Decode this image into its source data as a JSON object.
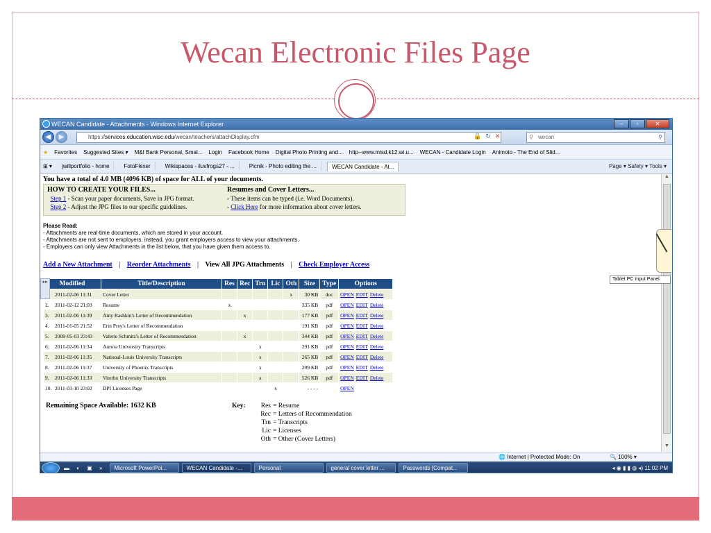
{
  "slide": {
    "title": "Wecan Electronic Files Page"
  },
  "window": {
    "title": "WECAN Candidate - Attachments - Windows Internet Explorer",
    "url_prefix": "https://",
    "url_domain": "services.education.wisc.edu",
    "url_path": "/wecan/teachers/attachDisplay.cfm",
    "search_value": "wecan"
  },
  "favorites": [
    "Favorites",
    "Suggested Sites ▾",
    "M&I Bank Personal, Smal...",
    "Login",
    "Facebook Home",
    "Digital Photo Printing and...",
    "http--www.misd.k12.wi.u...",
    "WECAN - Candidate Login",
    "Animoto - The End of Slid..."
  ],
  "tabs": [
    "jwillportfolio - home",
    "FotoFlexer",
    "Wikispaces - iluvfrogs27 - ...",
    "Picnik - Photo editing the ...",
    "WECAN Candidate - At..."
  ],
  "toolbar_tools": "Page ▾   Safety ▾   Tools ▾",
  "page": {
    "total_space": "You have a total of 4.0 MB (4096 KB) of space for ALL of your documents.",
    "howto": {
      "heading": "HOW TO CREATE YOUR FILES...",
      "step1_link": "Step 1",
      "step1_text": " - Scan your paper documents, Save in JPG format.",
      "step2_link": "Step 2",
      "step2_text": " - Adjust the JPG files to our specific guidelines.",
      "resumes_heading": "Resumes and Cover Letters...",
      "resumes_line1": "- These items can be typed (i.e. Word Documents).",
      "resumes_prefix": "- ",
      "resumes_link": "Click Here",
      "resumes_line2": " for more information about cover letters."
    },
    "please_read": {
      "heading": "Please Read:",
      "lines": [
        "- Attachments are real-time documents, which are stored in your account.",
        "- Attachments are not sent to employers, instead, you grant employers access to view your attachments.",
        "- Employers can only view Attachments in the list below, that you have given them access to."
      ]
    },
    "actions": {
      "add": "Add a New Attachment",
      "reorder": "Reorder Attachments",
      "view_all": "View All JPG Attachments",
      "check": "Check Employer Access",
      "sep": "|"
    },
    "table": {
      "headers": [
        "Modified",
        "Title/Description",
        "Res",
        "Rec",
        "Trn",
        "Lic",
        "Oth",
        "Size",
        "Type",
        "Options"
      ],
      "option_labels": [
        "OPEN",
        "EDIT",
        "Delete"
      ],
      "rows": [
        {
          "num": "1.",
          "modified": "2011-02-06 11:31",
          "title": "Cover Letter",
          "res": "",
          "rec": "",
          "trn": "",
          "lic": "",
          "oth": "x",
          "size": "30 KB",
          "type": "doc",
          "full": true
        },
        {
          "num": "2.",
          "modified": "2011-02-12 21:03",
          "title": "Resume",
          "res": "x",
          "rec": "",
          "trn": "",
          "lic": "",
          "oth": "",
          "size": "335 KB",
          "type": "pdf",
          "full": true
        },
        {
          "num": "3.",
          "modified": "2011-02-06 11:39",
          "title": "Amy Rashkin's Letter of Recommendation",
          "res": "",
          "rec": "x",
          "trn": "",
          "lic": "",
          "oth": "",
          "size": "177 KB",
          "type": "pdf",
          "full": true
        },
        {
          "num": "4.",
          "modified": "2011-01-05 21:52",
          "title": "Erin Prey's Letter of Recommendation",
          "res": "",
          "rec": "",
          "trn": "",
          "lic": "",
          "oth": "",
          "size": "191 KB",
          "type": "pdf",
          "full": true
        },
        {
          "num": "5.",
          "modified": "2009-05-03 23:43",
          "title": "Valerie Schmitz's Letter of Recommendation",
          "res": "",
          "rec": "x",
          "trn": "",
          "lic": "",
          "oth": "",
          "size": "344 KB",
          "type": "pdf",
          "full": true
        },
        {
          "num": "6.",
          "modified": "2011-02-06 11:34",
          "title": "Aurora University Transcripts",
          "res": "",
          "rec": "",
          "trn": "x",
          "lic": "",
          "oth": "",
          "size": "291 KB",
          "type": "pdf",
          "full": true
        },
        {
          "num": "7.",
          "modified": "2011-02-06 11:35",
          "title": "National-Louis University Transcripts",
          "res": "",
          "rec": "",
          "trn": "x",
          "lic": "",
          "oth": "",
          "size": "265 KB",
          "type": "pdf",
          "full": true
        },
        {
          "num": "8.",
          "modified": "2011-02-06 11:37",
          "title": "University of Phoenix Transcripts",
          "res": "",
          "rec": "",
          "trn": "x",
          "lic": "",
          "oth": "",
          "size": "299 KB",
          "type": "pdf",
          "full": true
        },
        {
          "num": "9.",
          "modified": "2011-02-06 11:33",
          "title": "Viterbo University Transcripts",
          "res": "",
          "rec": "",
          "trn": "x",
          "lic": "",
          "oth": "",
          "size": "526 KB",
          "type": "pdf",
          "full": true
        },
        {
          "num": "10.",
          "modified": "2011-03-10 23:02",
          "title": "DPI Licenses Page",
          "res": "",
          "rec": "",
          "trn": "",
          "lic": "x",
          "oth": "",
          "size": "- - - -",
          "type": "",
          "full": false
        }
      ]
    },
    "remaining": "Remaining Space Available: 1632 KB",
    "key": {
      "label": "Key:",
      "items": [
        {
          "k": "Res",
          "v": "= Resume"
        },
        {
          "k": "Rec",
          "v": "= Letters of Recommendation"
        },
        {
          "k": "Trn",
          "v": "= Transcripts"
        },
        {
          "k": "Lic",
          "v": "= Licenses"
        },
        {
          "k": "Oth",
          "v": "= Other (Cover Letters)"
        }
      ]
    }
  },
  "status": {
    "zone": "Internet | Protected Mode: On",
    "zoom": "100%"
  },
  "tablet_tip": "Tablet PC Input Panel",
  "taskbar": {
    "items": [
      "Microsoft PowerPoi...",
      "WECAN Candidate -...",
      "Personal",
      "general cover letter ...",
      "Passwords [Compat..."
    ],
    "active_index": 1,
    "time": "11:02 PM"
  }
}
